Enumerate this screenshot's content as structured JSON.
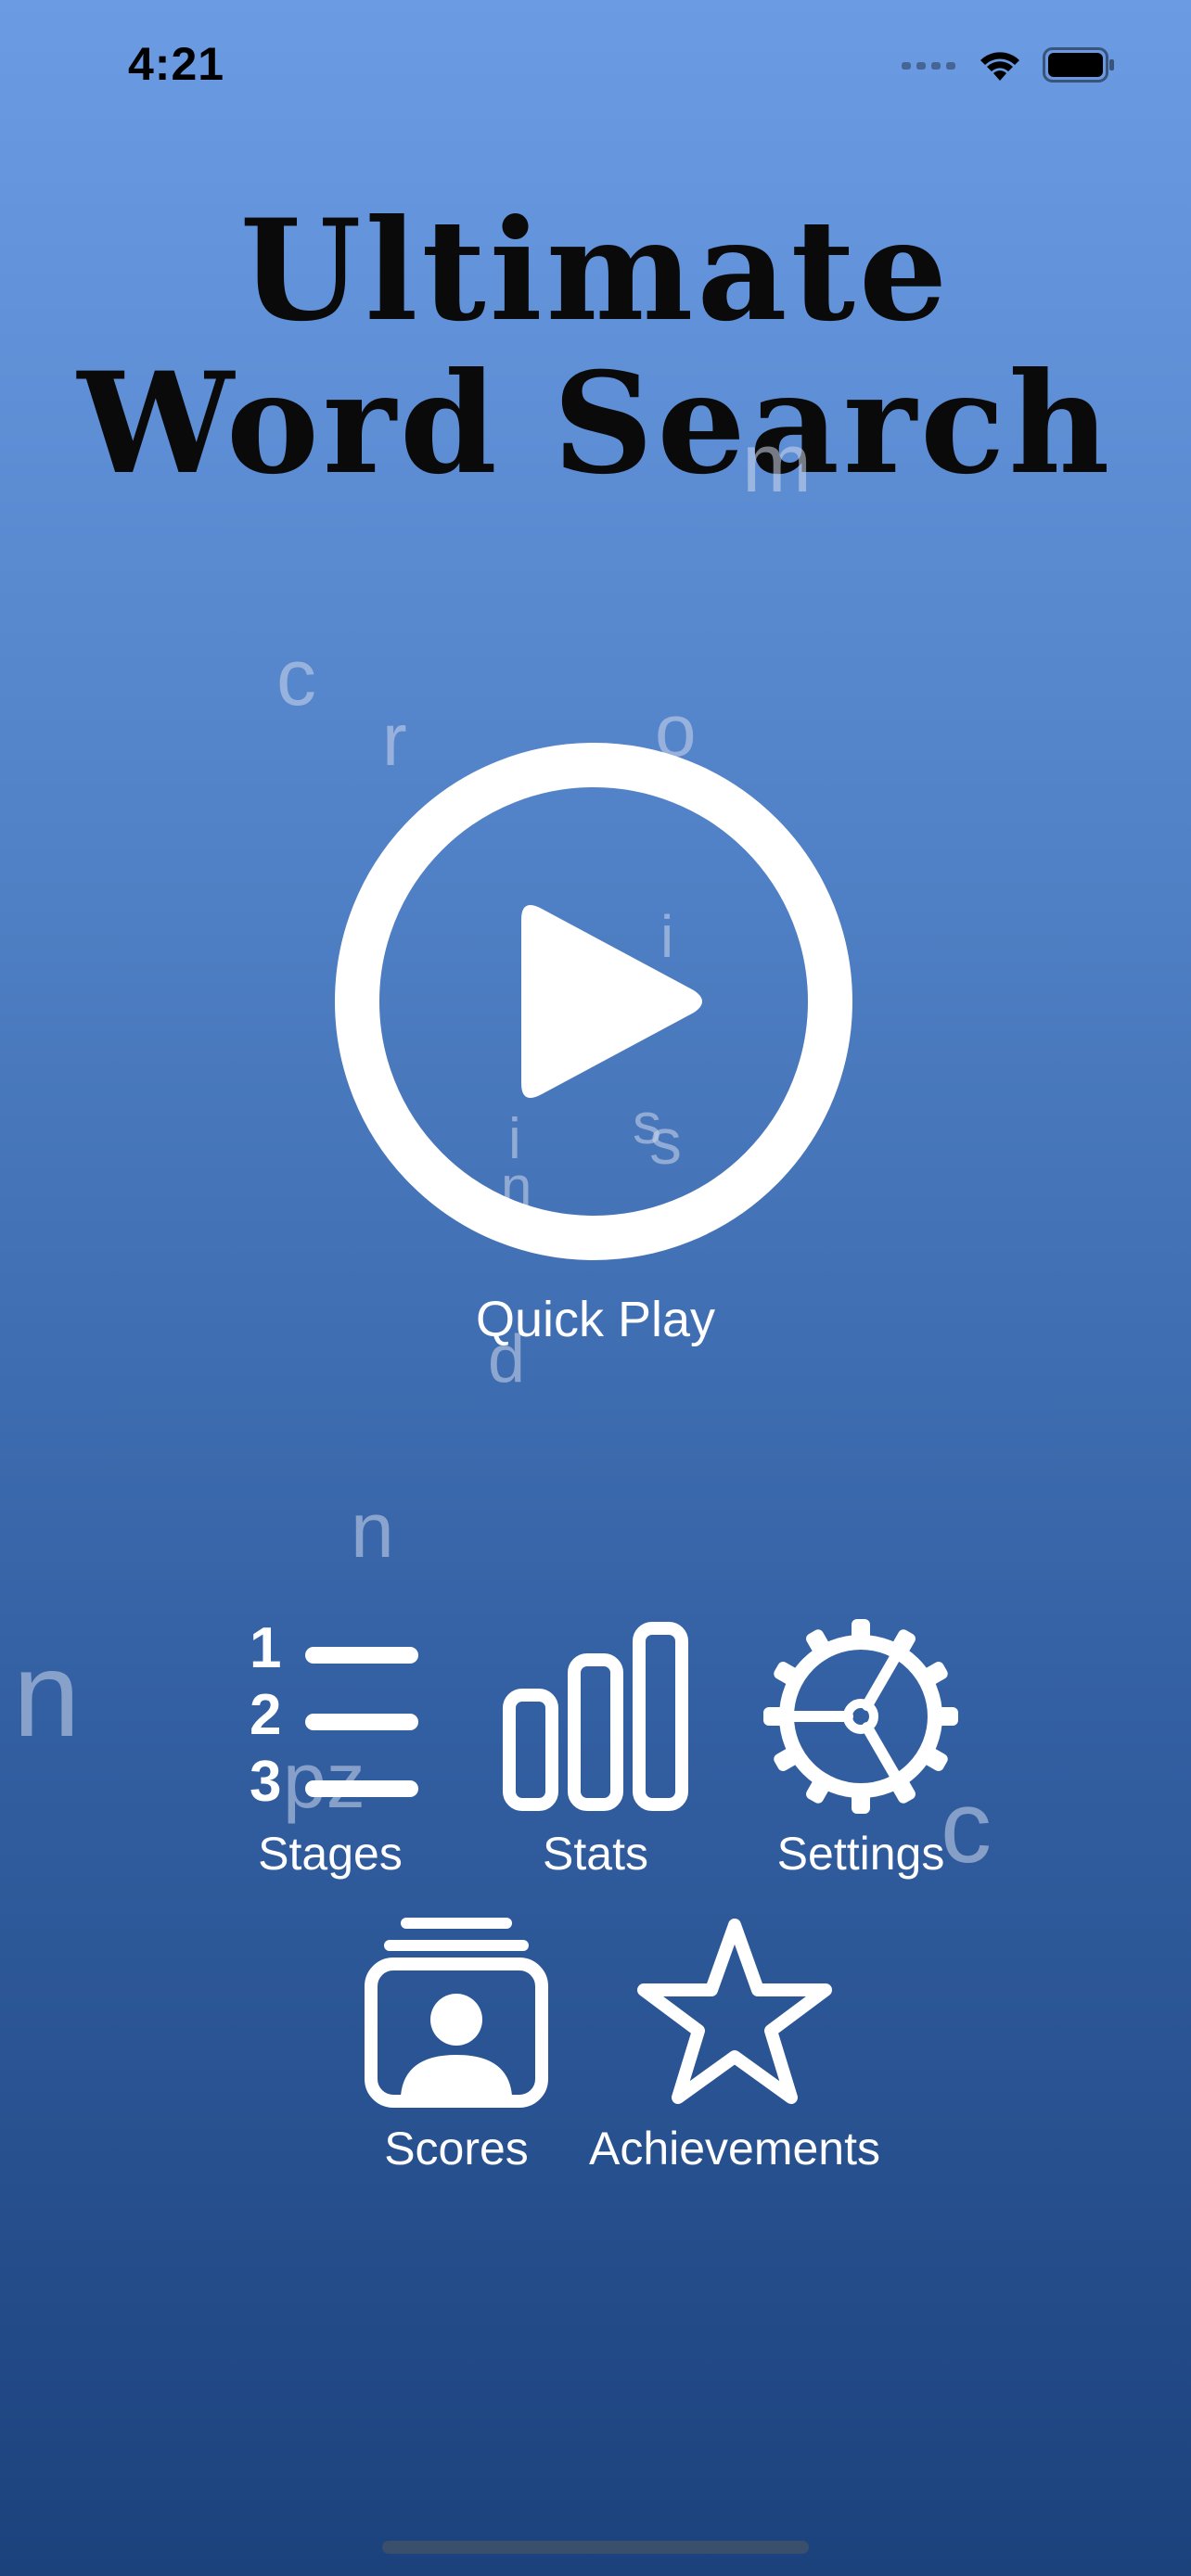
{
  "status_bar": {
    "time": "4:21",
    "icons": [
      "cellular-signal-icon",
      "wifi-icon",
      "battery-icon"
    ]
  },
  "title": {
    "line1": "Ultimate",
    "line2": "Word Search"
  },
  "background_letters": [
    "m",
    "c",
    "r",
    "o",
    "i",
    "i",
    "s",
    "s",
    "n",
    "d",
    "n",
    "n",
    "pz",
    "c"
  ],
  "quick_play": {
    "label": "Quick Play",
    "icon": "play-circle-icon"
  },
  "menu": {
    "stages": {
      "label": "Stages",
      "icon": "numbered-list-icon"
    },
    "stats": {
      "label": "Stats",
      "icon": "bar-chart-icon"
    },
    "settings": {
      "label": "Settings",
      "icon": "gear-icon"
    },
    "scores": {
      "label": "Scores",
      "icon": "leaderboard-contact-icon"
    },
    "achievements": {
      "label": "Achievements",
      "icon": "star-icon"
    }
  },
  "colors": {
    "gradient_top": "#6b9be3",
    "gradient_bottom": "#1c427c",
    "title_text": "#0a0a0a",
    "icon_white": "#ffffff"
  }
}
